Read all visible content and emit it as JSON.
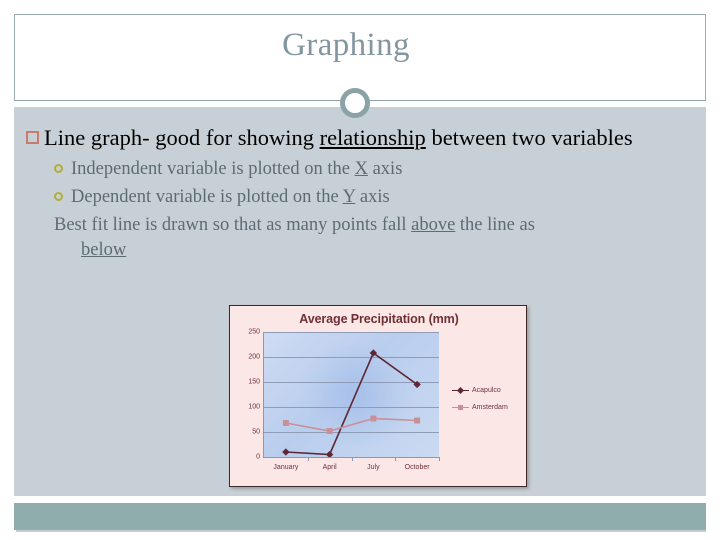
{
  "slide": {
    "title": "Graphing",
    "decor_ring_icon": "ring-icon"
  },
  "content": {
    "bullet_level1": {
      "marker": "square-outline-bullet",
      "parts": [
        "Line graph- good for showing ",
        "relationship",
        " between two variables"
      ],
      "underlined": "relationship",
      "text_before": "Line graph- good for showing ",
      "text_after": " between two variables"
    },
    "sub_bullets": [
      {
        "marker": "circle-outline-bullet",
        "text_before": "Independent variable is plotted on the ",
        "underlined": "X",
        "text_after": " axis"
      },
      {
        "marker": "circle-outline-bullet",
        "text_before": "Dependent variable is plotted on the ",
        "underlined": "Y",
        "text_after": " axis"
      }
    ],
    "plain_line": {
      "text_before": "Best fit line is drawn so that as many points fall ",
      "underlined_1": "above",
      "text_middle": " the line as",
      "underlined_2": "below"
    }
  },
  "colors": {
    "title": "#8396a0",
    "body_background": "#c6d0d6",
    "footer_bar": "#8fadac",
    "square_bullet": "#c77b6b",
    "circle_bullet": "#b2ac39",
    "sub_text": "#5d6b75",
    "chart_background": "#fbe8e6",
    "chart_text": "#6f3038",
    "series_acapulco": "#5d2733",
    "series_amsterdam": "#c99098"
  },
  "chart_data": {
    "type": "line",
    "title": "Average Precipitation (mm)",
    "xlabel": "",
    "ylabel": "",
    "categories": [
      "January",
      "April",
      "July",
      "October"
    ],
    "series": [
      {
        "name": "Acapulco",
        "values": [
          10,
          5,
          208,
          145
        ],
        "color": "#5d2733",
        "marker": "diamond"
      },
      {
        "name": "Amsterdam",
        "values": [
          68,
          52,
          77,
          73
        ],
        "color": "#c99098",
        "marker": "square"
      }
    ],
    "ylim": [
      0,
      250
    ],
    "yticks": [
      0,
      50,
      100,
      150,
      200,
      250
    ],
    "grid": true,
    "legend_position": "right"
  }
}
